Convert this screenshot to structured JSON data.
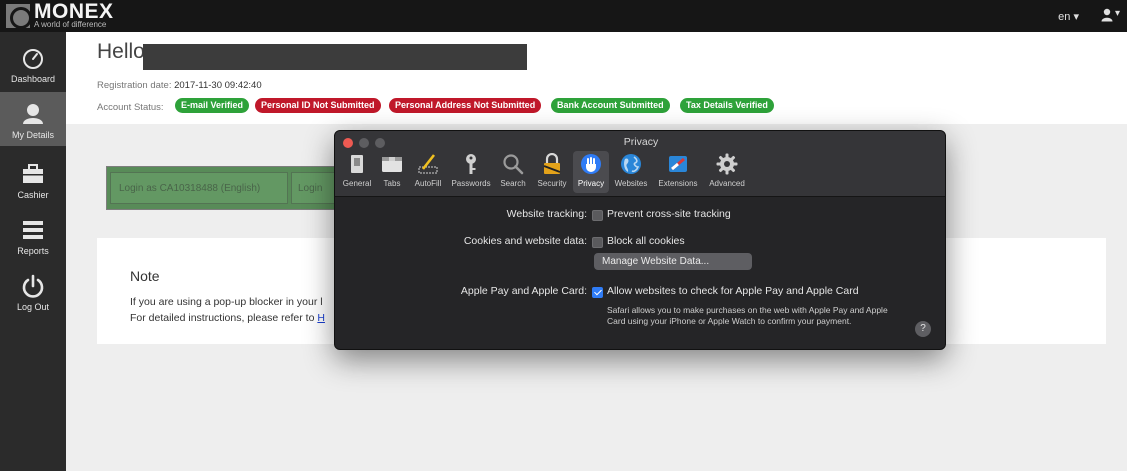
{
  "brand": {
    "name": "MONEX",
    "tagline": "A world of difference"
  },
  "topbar": {
    "language": "en ▾",
    "user_caret": "▾"
  },
  "sidebar": {
    "items": [
      {
        "label": "Dashboard",
        "icon": "dashboard-gauge-icon",
        "active": false
      },
      {
        "label": "My Details",
        "icon": "user-icon",
        "active": true
      },
      {
        "label": "Cashier",
        "icon": "briefcase-icon",
        "active": false
      },
      {
        "label": "Reports",
        "icon": "list-icon",
        "active": false
      },
      {
        "label": "Log Out",
        "icon": "power-icon",
        "active": false
      }
    ]
  },
  "profile": {
    "greeting": "Hello",
    "registration_label": "Registration date:",
    "registration_value": "2017-11-30 09:42:40",
    "account_status_label": "Account Status:",
    "badges": [
      {
        "label": "E-mail Verified",
        "color": "#2ea23a"
      },
      {
        "label": "Personal ID Not Submitted",
        "color": "#c0182a"
      },
      {
        "label": "Personal Address Not Submitted",
        "color": "#c0182a"
      },
      {
        "label": "Bank Account Submitted",
        "color": "#2ea23a"
      },
      {
        "label": "Tax Details Verified",
        "color": "#2ea23a"
      }
    ]
  },
  "login_bar": {
    "primary": "Login as CA10318488 (English)",
    "secondary": "Login"
  },
  "note": {
    "title": "Note",
    "line1": "If you are using a pop-up blocker in your l",
    "line2_prefix": "For detailed instructions, please refer to ",
    "line2_link": "H"
  },
  "prefs_window": {
    "title": "Privacy",
    "tabs": [
      {
        "label": "General",
        "icon": "general-switch-icon"
      },
      {
        "label": "Tabs",
        "icon": "tabs-icon"
      },
      {
        "label": "AutoFill",
        "icon": "autofill-pencil-icon"
      },
      {
        "label": "Passwords",
        "icon": "key-icon"
      },
      {
        "label": "Search",
        "icon": "magnifier-icon"
      },
      {
        "label": "Security",
        "icon": "padlock-icon"
      },
      {
        "label": "Privacy",
        "icon": "hand-icon",
        "active": true
      },
      {
        "label": "Websites",
        "icon": "globe-icon"
      },
      {
        "label": "Extensions",
        "icon": "puzzle-icon"
      },
      {
        "label": "Advanced",
        "icon": "gear-icon"
      }
    ],
    "tracking_label": "Website tracking:",
    "tracking_option": "Prevent cross-site tracking",
    "tracking_checked": false,
    "cookies_label": "Cookies and website data:",
    "cookies_option": "Block all cookies",
    "cookies_checked": false,
    "manage_button": "Manage Website Data...",
    "pay_label": "Apple Pay and Apple Card:",
    "pay_option": "Allow websites to check for Apple Pay and Apple Card",
    "pay_checked": true,
    "pay_description": "Safari allows you to make purchases on the web with Apple Pay and Apple Card using your iPhone or Apple Watch to confirm your payment.",
    "help": "?"
  }
}
